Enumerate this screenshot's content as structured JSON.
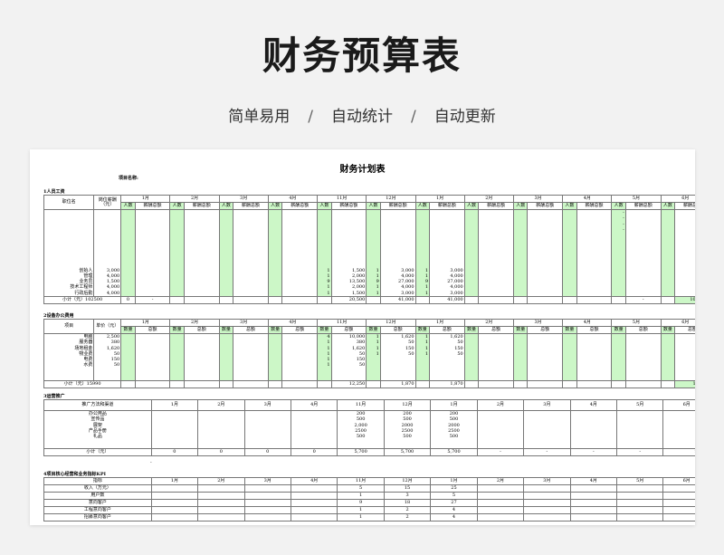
{
  "hero": {
    "title": "财务预算表",
    "tags": [
      "简单易用",
      "自动统计",
      "自动更新"
    ],
    "separator": "/"
  },
  "sheet": {
    "title": "财务计划表",
    "project_label": "项目名称:",
    "months_full": [
      "1月",
      "2月",
      "3月",
      "4月",
      "11月",
      "12月",
      "1月",
      "2月",
      "3月",
      "4月",
      "5月",
      "6月"
    ],
    "section1": {
      "label": "1人员工资",
      "col_name": "职位名",
      "col_salary": "岗位薪酬（元）",
      "sub_people": "人数",
      "sub_total": "薪酬总额",
      "names": [
        "创始人",
        "管理",
        "业务员",
        "技术工程师",
        "行政后勤"
      ],
      "salaries": [
        "3,000",
        "4,000",
        "1,500",
        "4,000",
        "4,000"
      ],
      "m11_people": [
        "1",
        "1",
        "9",
        "1",
        "1"
      ],
      "m11_total": [
        "1,500",
        "2,000",
        "13,500",
        "2,000",
        "1,500"
      ],
      "m12_people": [
        "1",
        "1",
        "9",
        "1",
        "1"
      ],
      "m12_total": [
        "3,000",
        "4,000",
        "27,000",
        "4,000",
        "3,000"
      ],
      "m1b_people": [
        "1",
        "1",
        "9",
        "1",
        "1"
      ],
      "m1b_total": [
        "3,000",
        "4,000",
        "27,000",
        "4,000",
        "3,000"
      ],
      "dash_stack": [
        "-",
        "-",
        "-",
        "-",
        "-",
        "-",
        "-",
        "-",
        "-",
        "-",
        "-",
        "-",
        "-",
        "-"
      ],
      "dash_short": [
        "-",
        "-",
        "-",
        "-"
      ],
      "subtotal_label": "小计（元）102500",
      "subtotal_zero": "0",
      "dash": "-",
      "subtotal_m11": "20,500",
      "subtotal_m12": "41,000",
      "subtotal_m1b": "41,000",
      "grand_total": "102,500"
    },
    "section2": {
      "label": "2设备办公费用",
      "col_name": "项目",
      "col_price": "单价（元）",
      "sub_qty": "数量",
      "sub_total": "总额",
      "names": [
        "电脑",
        "服务器",
        "场地租金",
        "物业费",
        "电费",
        "水费"
      ],
      "prices": [
        "2,500",
        "380",
        "1,620",
        "50",
        "150",
        "50"
      ],
      "m11_qty": [
        "4",
        "1",
        "1",
        "1",
        "1",
        "1"
      ],
      "m11_total": [
        "10,000",
        "380",
        "1,620",
        "50",
        "150",
        "50"
      ],
      "m12_qty": [
        "",
        "",
        "1",
        "1",
        "1",
        "1"
      ],
      "m12_total": [
        "",
        "",
        "1,620",
        "50",
        "150",
        "50"
      ],
      "m1b_qty": [
        "",
        "",
        "1",
        "1",
        "1",
        "1"
      ],
      "m1b_total": [
        "",
        "",
        "1,620",
        "50",
        "150",
        "50"
      ],
      "subtotal_label": "小计（元）15990",
      "subtotal_m11": "12,250",
      "subtotal_m12": "1,870",
      "subtotal_m1b": "1,870",
      "grand_total": "15,990"
    },
    "section3": {
      "label": "3运营推广",
      "col_name": "推广方法和渠道",
      "items": [
        "办公用品",
        "宣传品",
        "展架",
        "产品手册",
        "礼品"
      ],
      "m11": [
        "200",
        "500",
        "2,000",
        "2500",
        "500"
      ],
      "m12": [
        "200",
        "500",
        "2000",
        "2500",
        "500"
      ],
      "m1b": [
        "200",
        "500",
        "2000",
        "2500",
        "500"
      ],
      "subtotal_label": "小计（元）",
      "zero": "0",
      "subtotal_m11": "5,700",
      "subtotal_m12": "5,700",
      "subtotal_m1b": "5,700",
      "grand_total": "17100",
      "dash": "-"
    },
    "section4": {
      "label": "4项目核心经营和业务指标KPI",
      "col_name": "指标",
      "rows": [
        {
          "name": "收入（万元）",
          "m11": "5",
          "m12": "15",
          "m1b": "25"
        },
        {
          "name": "用户数",
          "m11": "1",
          "m12": "3",
          "m1b": "5"
        },
        {
          "name": "意向客户",
          "m11": "9",
          "m12": "18",
          "m1b": "27"
        },
        {
          "name": "工程意向客户",
          "m11": "1",
          "m12": "2",
          "m1b": "4"
        },
        {
          "name": "招募意向客户",
          "m11": "1",
          "m12": "2",
          "m1b": "4"
        }
      ]
    }
  }
}
